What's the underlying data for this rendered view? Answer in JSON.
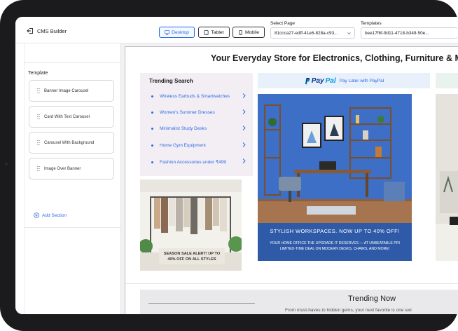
{
  "header": {
    "app_title": "CMS Builder",
    "device_buttons": [
      {
        "label": "Desktop",
        "active": true
      },
      {
        "label": "Tablet",
        "active": false
      },
      {
        "label": "Mobile",
        "active": false
      }
    ],
    "select_page": {
      "label": "Select Page",
      "value": "81ccca27-edff-41e6-828a-c93..."
    },
    "templates": {
      "label": "Templates",
      "value": "bee17f6f-9d11-4718-b349-50e..."
    }
  },
  "sidebar": {
    "title": "Template",
    "templates": [
      "Banner Image Carousel",
      "Card With Text Carousel",
      "Carousel With Background",
      "Image Over Banner"
    ],
    "add_section_label": "Add Section"
  },
  "preview": {
    "store_title": "Your Everyday Store for Electronics, Clothing, Furniture & Mo",
    "trending_search": {
      "title": "Trending Search",
      "items": [
        "Wireless Earbuds & Smartwatches",
        "Women's Summer Dresses",
        "Minimalist Study Desks",
        "Home Gym Equipment",
        "Fashion Accessories under ₹499"
      ]
    },
    "paypal": {
      "logo_1": "Pay",
      "logo_2": "Pal",
      "text": "Pay Later with PayPal"
    },
    "office_banner": {
      "headline": "STYLISH WORKSPACES. NOW UP TO 40% OFF!",
      "line1": "YOUR HOME OFFICE THE UPGRADE IT DESERVES — AT UNBEATABLE PRI",
      "line2": "LIMITED-TIME DEAL ON MODERN DESKS, CHAIRS, AND MORE!"
    },
    "clothes_banner": {
      "line1": "SEASON SALE ALERT! UP TO",
      "line2": "40% OFF ON ALL STYLES"
    },
    "trending_now": {
      "title": "Trending Now",
      "subtitle": "From must-haves to hidden gems, your next favorite is one swi"
    }
  },
  "colors": {
    "accent": "#2d6ae3",
    "frame": "#1b1b1d",
    "banner_blue": "#2f5aa8",
    "trend_bg": "#f3eef4"
  }
}
